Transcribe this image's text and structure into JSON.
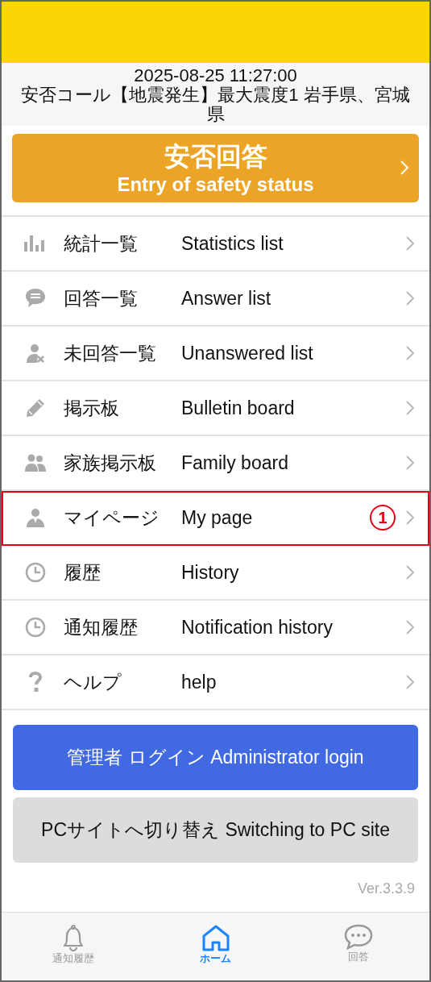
{
  "notice": {
    "datetime": "2025-08-25 11:27:00",
    "message": "安否コール【地震発生】最大震度1 岩手県、宮城県"
  },
  "answer_button": {
    "title": "安否回答",
    "subtitle": "Entry of safety status"
  },
  "menu": [
    {
      "label": "統計一覧",
      "label_en": "Statistics list",
      "highlighted": false
    },
    {
      "label": "回答一覧",
      "label_en": "Answer list",
      "highlighted": false
    },
    {
      "label": "未回答一覧",
      "label_en": "Unanswered list",
      "highlighted": false
    },
    {
      "label": "掲示板",
      "label_en": "Bulletin board",
      "highlighted": false
    },
    {
      "label": "家族掲示板",
      "label_en": "Family board",
      "highlighted": false
    },
    {
      "label": "マイページ",
      "label_en": "My page",
      "highlighted": true,
      "callout": "1"
    },
    {
      "label": "履歴",
      "label_en": "History",
      "highlighted": false
    },
    {
      "label": "通知履歴",
      "label_en": "Notification history",
      "highlighted": false
    },
    {
      "label": "ヘルプ",
      "label_en": "help",
      "highlighted": false
    }
  ],
  "admin_button": "管理者 ログイン Administrator login",
  "pc_button": "PCサイトへ切り替え Switching to PC site",
  "version": "Ver.3.3.9",
  "tabs": [
    {
      "label": "通知履歴",
      "selected": false
    },
    {
      "label": "ホーム",
      "selected": true
    },
    {
      "label": "回答",
      "selected": false
    }
  ]
}
